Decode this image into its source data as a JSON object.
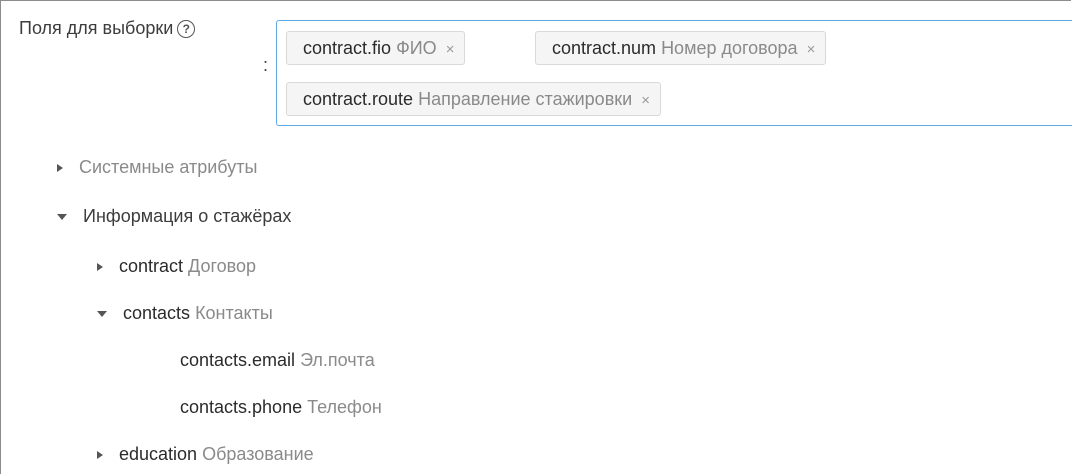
{
  "field": {
    "label": "Поля для выборки",
    "help_glyph": "?",
    "colon": ":"
  },
  "selected_tags": [
    {
      "key": "contract.fio",
      "desc": "ФИО",
      "close": "×"
    },
    {
      "key": "contract.num",
      "desc": "Номер договора",
      "close": "×"
    },
    {
      "key": "contract.route",
      "desc": "Направление стажировки",
      "close": "×"
    }
  ],
  "tree": {
    "system": {
      "label": "Системные атрибуты",
      "expanded": false
    },
    "interns": {
      "label": "Информация о стажёрах",
      "expanded": true
    },
    "contract": {
      "key": "contract",
      "desc": "Договор",
      "expanded": false
    },
    "contacts": {
      "key": "contacts",
      "desc": "Контакты",
      "expanded": true
    },
    "contacts_email": {
      "key": "contacts.email",
      "desc": "Эл.почта"
    },
    "contacts_phone": {
      "key": "contacts.phone",
      "desc": "Телефон"
    },
    "education": {
      "key": "education",
      "desc": "Образование",
      "expanded": false
    }
  },
  "colors": {
    "focus_border": "#5fa8e6",
    "tag_bg": "#f5f5f5",
    "muted_text": "#8a8a8a"
  }
}
